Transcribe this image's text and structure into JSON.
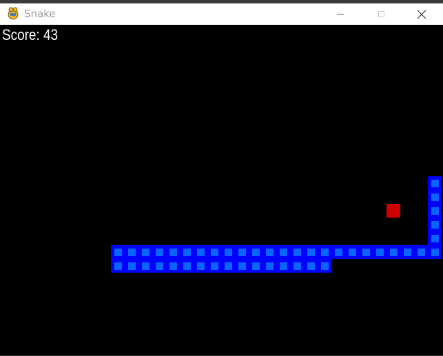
{
  "window": {
    "title": "Snake",
    "icon": "pygame-snake-icon",
    "controls": [
      "minimize",
      "maximize",
      "close"
    ]
  },
  "game": {
    "score_text": "Score: 43",
    "background": "#000000",
    "snake_color": "#0000ff",
    "snake_inner_color": "#0a64ff",
    "food_color": "#cc0000",
    "grid_cell_size": 20,
    "snake_cells": [
      [
        8,
        17
      ],
      [
        9,
        17
      ],
      [
        10,
        17
      ],
      [
        11,
        17
      ],
      [
        12,
        17
      ],
      [
        13,
        17
      ],
      [
        14,
        17
      ],
      [
        15,
        17
      ],
      [
        16,
        17
      ],
      [
        17,
        17
      ],
      [
        18,
        17
      ],
      [
        19,
        17
      ],
      [
        20,
        17
      ],
      [
        21,
        17
      ],
      [
        22,
        17
      ],
      [
        23,
        17
      ],
      [
        8,
        16
      ],
      [
        9,
        16
      ],
      [
        10,
        16
      ],
      [
        11,
        16
      ],
      [
        12,
        16
      ],
      [
        13,
        16
      ],
      [
        14,
        16
      ],
      [
        15,
        16
      ],
      [
        16,
        16
      ],
      [
        17,
        16
      ],
      [
        18,
        16
      ],
      [
        19,
        16
      ],
      [
        20,
        16
      ],
      [
        21,
        16
      ],
      [
        22,
        16
      ],
      [
        23,
        16
      ],
      [
        24,
        16
      ],
      [
        25,
        16
      ],
      [
        26,
        16
      ],
      [
        27,
        16
      ],
      [
        28,
        16
      ],
      [
        29,
        16
      ],
      [
        30,
        16
      ],
      [
        31,
        16
      ],
      [
        31,
        15
      ],
      [
        31,
        14
      ],
      [
        31,
        13
      ],
      [
        31,
        12
      ],
      [
        31,
        11
      ]
    ],
    "food_cell": [
      28,
      13
    ]
  }
}
